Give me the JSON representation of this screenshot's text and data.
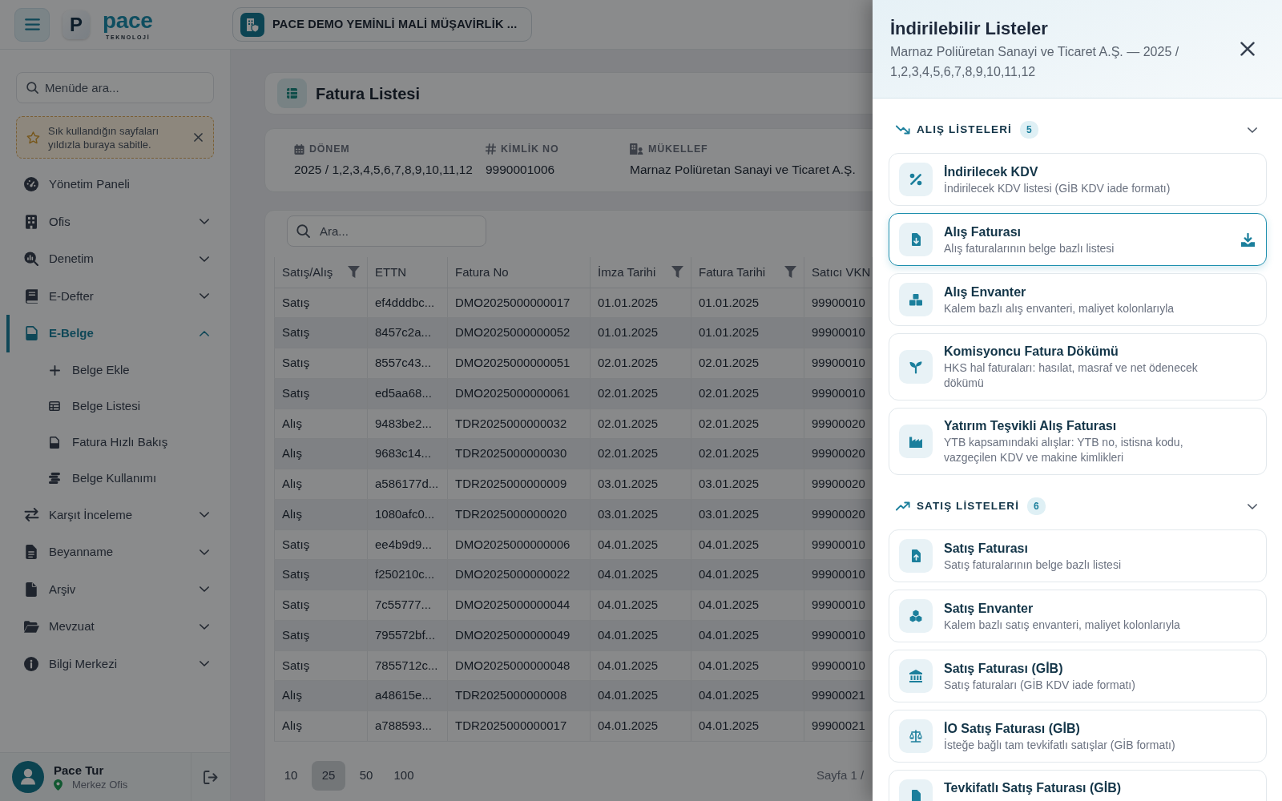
{
  "topbar": {
    "logo_letter": "P",
    "brand_name": "pace",
    "brand_tagline": "TEKNOLOJİ",
    "company": "PACE DEMO YEMİNLİ MALİ MÜŞAVİRLİK ..."
  },
  "sidebar": {
    "search": {
      "placeholder": "Menüde ara..."
    },
    "hint": "Sık kullandığın sayfaları yıldızla buraya sabitle.",
    "items": [
      {
        "kind": "link",
        "label": "Yönetim Paneli",
        "selected": false
      },
      {
        "kind": "group",
        "label": "Ofis",
        "selected": false,
        "expanded": false
      },
      {
        "kind": "group",
        "label": "Denetim",
        "selected": false,
        "expanded": false
      },
      {
        "kind": "group",
        "label": "E-Defter",
        "selected": false,
        "expanded": false
      },
      {
        "kind": "group",
        "label": "E-Belge",
        "selected": true,
        "expanded": true,
        "children": [
          {
            "label": "Belge Ekle",
            "selected": false
          },
          {
            "label": "Belge Listesi",
            "selected": false
          },
          {
            "label": "Fatura Hızlı Bakış",
            "selected": false
          },
          {
            "label": "Belge Kullanımı",
            "selected": false
          }
        ]
      },
      {
        "kind": "group",
        "label": "Karşıt İnceleme",
        "selected": false,
        "expanded": false
      },
      {
        "kind": "group",
        "label": "Beyanname",
        "selected": false,
        "expanded": false
      },
      {
        "kind": "group",
        "label": "Arşiv",
        "selected": false,
        "expanded": false
      },
      {
        "kind": "group",
        "label": "Mevzuat",
        "selected": false,
        "expanded": false
      },
      {
        "kind": "group",
        "label": "Bilgi Merkezi",
        "selected": false,
        "expanded": false
      }
    ],
    "user": {
      "name": "Pace Tur",
      "location": "Merkez Ofis"
    }
  },
  "page": {
    "title": "Fatura Listesi",
    "info": [
      {
        "label": "DÖNEM",
        "value": "2025 / 1,2,3,4,5,6,7,8,9,10,11,12"
      },
      {
        "label": "KİMLİK NO",
        "value": "9990001006"
      },
      {
        "label": "MÜKELLEF",
        "value": "Marnaz Poliüretan Sanayi ve Ticaret A.Ş."
      }
    ]
  },
  "table": {
    "search": {
      "placeholder": "Ara..."
    },
    "columns": [
      {
        "label": "Satış/Alış",
        "filter": true
      },
      {
        "label": "ETTN",
        "filter": false
      },
      {
        "label": "Fatura No",
        "filter": false
      },
      {
        "label": "İmza Tarihi",
        "filter": true
      },
      {
        "label": "Fatura Tarihi",
        "filter": true
      },
      {
        "label": "Satıcı VKN",
        "filter": false
      }
    ],
    "rows": [
      [
        "Satış",
        "ef4dddbc...",
        "DMO2025000000017",
        "01.01.2025",
        "01.01.2025",
        "99900010"
      ],
      [
        "Satış",
        "8457c2a...",
        "DMO2025000000052",
        "01.01.2025",
        "01.01.2025",
        "99900010"
      ],
      [
        "Satış",
        "8557c43...",
        "DMO2025000000051",
        "02.01.2025",
        "02.01.2025",
        "99900010"
      ],
      [
        "Satış",
        "ed5aa68...",
        "DMO2025000000061",
        "02.01.2025",
        "02.01.2025",
        "99900010"
      ],
      [
        "Alış",
        "9483be2...",
        "TDR2025000000032",
        "02.01.2025",
        "02.01.2025",
        "99900020"
      ],
      [
        "Alış",
        "9683c14...",
        "TDR2025000000030",
        "02.01.2025",
        "02.01.2025",
        "99900020"
      ],
      [
        "Alış",
        "a586177d...",
        "TDR2025000000009",
        "03.01.2025",
        "03.01.2025",
        "99900020"
      ],
      [
        "Alış",
        "1080afc0...",
        "TDR2025000000020",
        "03.01.2025",
        "03.01.2025",
        "99900020"
      ],
      [
        "Satış",
        "ee4b9d9...",
        "DMO2025000000006",
        "04.01.2025",
        "04.01.2025",
        "99900010"
      ],
      [
        "Satış",
        "f250210c...",
        "DMO2025000000022",
        "04.01.2025",
        "04.01.2025",
        "99900010"
      ],
      [
        "Satış",
        "7c55777...",
        "DMO2025000000044",
        "04.01.2025",
        "04.01.2025",
        "99900010"
      ],
      [
        "Satış",
        "795572bf...",
        "DMO2025000000049",
        "04.01.2025",
        "04.01.2025",
        "99900010"
      ],
      [
        "Satış",
        "7855712c...",
        "DMO2025000000048",
        "04.01.2025",
        "04.01.2025",
        "99900010"
      ],
      [
        "Alış",
        "a48615e...",
        "TDR2025000000008",
        "04.01.2025",
        "04.01.2025",
        "99900021"
      ],
      [
        "Alış",
        "a788593...",
        "TDR2025000000017",
        "04.01.2025",
        "04.01.2025",
        "99900021"
      ]
    ],
    "page_sizes": [
      {
        "label": "10",
        "selected": false
      },
      {
        "label": "25",
        "selected": true
      },
      {
        "label": "50",
        "selected": false
      },
      {
        "label": "100",
        "selected": false
      }
    ],
    "page_info": "Sayfa 1 /"
  },
  "drawer": {
    "title": "İndirilebilir Listeler",
    "subtitle": "Marnaz Poliüretan Sanayi ve Ticaret A.Ş. — 2025 / 1,2,3,4,5,6,7,8,9,10,11,12",
    "sections": [
      {
        "title": "ALIŞ LİSTELERİ",
        "count": "5",
        "expanded": true,
        "items": [
          {
            "title": "İndirilecek KDV",
            "description": "İndirilecek KDV listesi (GİB KDV iade formatı)",
            "selected": false
          },
          {
            "title": "Alış Faturası",
            "description": "Alış faturalarının belge bazlı listesi",
            "selected": true
          },
          {
            "title": "Alış Envanter",
            "description": "Kalem bazlı alış envanteri, maliyet kolonlarıyla",
            "selected": false
          },
          {
            "title": "Komisyoncu Fatura Dökümü",
            "description": "HKS hal faturaları: hasılat, masraf ve net ödenecek dökümü",
            "selected": false
          },
          {
            "title": "Yatırım Teşvikli Alış Faturası",
            "description": "YTB kapsamındaki alışlar: YTB no, istisna kodu, vazgeçilen KDV ve makine kimlikleri",
            "selected": false
          }
        ]
      },
      {
        "title": "SATIŞ LİSTELERİ",
        "count": "6",
        "expanded": true,
        "items": [
          {
            "title": "Satış Faturası",
            "description": "Satış faturalarının belge bazlı listesi",
            "selected": false
          },
          {
            "title": "Satış Envanter",
            "description": "Kalem bazlı satış envanteri, maliyet kolonlarıyla",
            "selected": false
          },
          {
            "title": "Satış Faturası (GİB)",
            "description": "Satış faturaları (GİB KDV iade formatı)",
            "selected": false
          },
          {
            "title": "İO Satış Faturası (GİB)",
            "description": "İsteğe bağlı tam tevkifatlı satışlar (GİB formatı)",
            "selected": false
          },
          {
            "title": "Tevkifatlı Satış Faturası (GİB)",
            "selected": false
          }
        ]
      }
    ]
  }
}
